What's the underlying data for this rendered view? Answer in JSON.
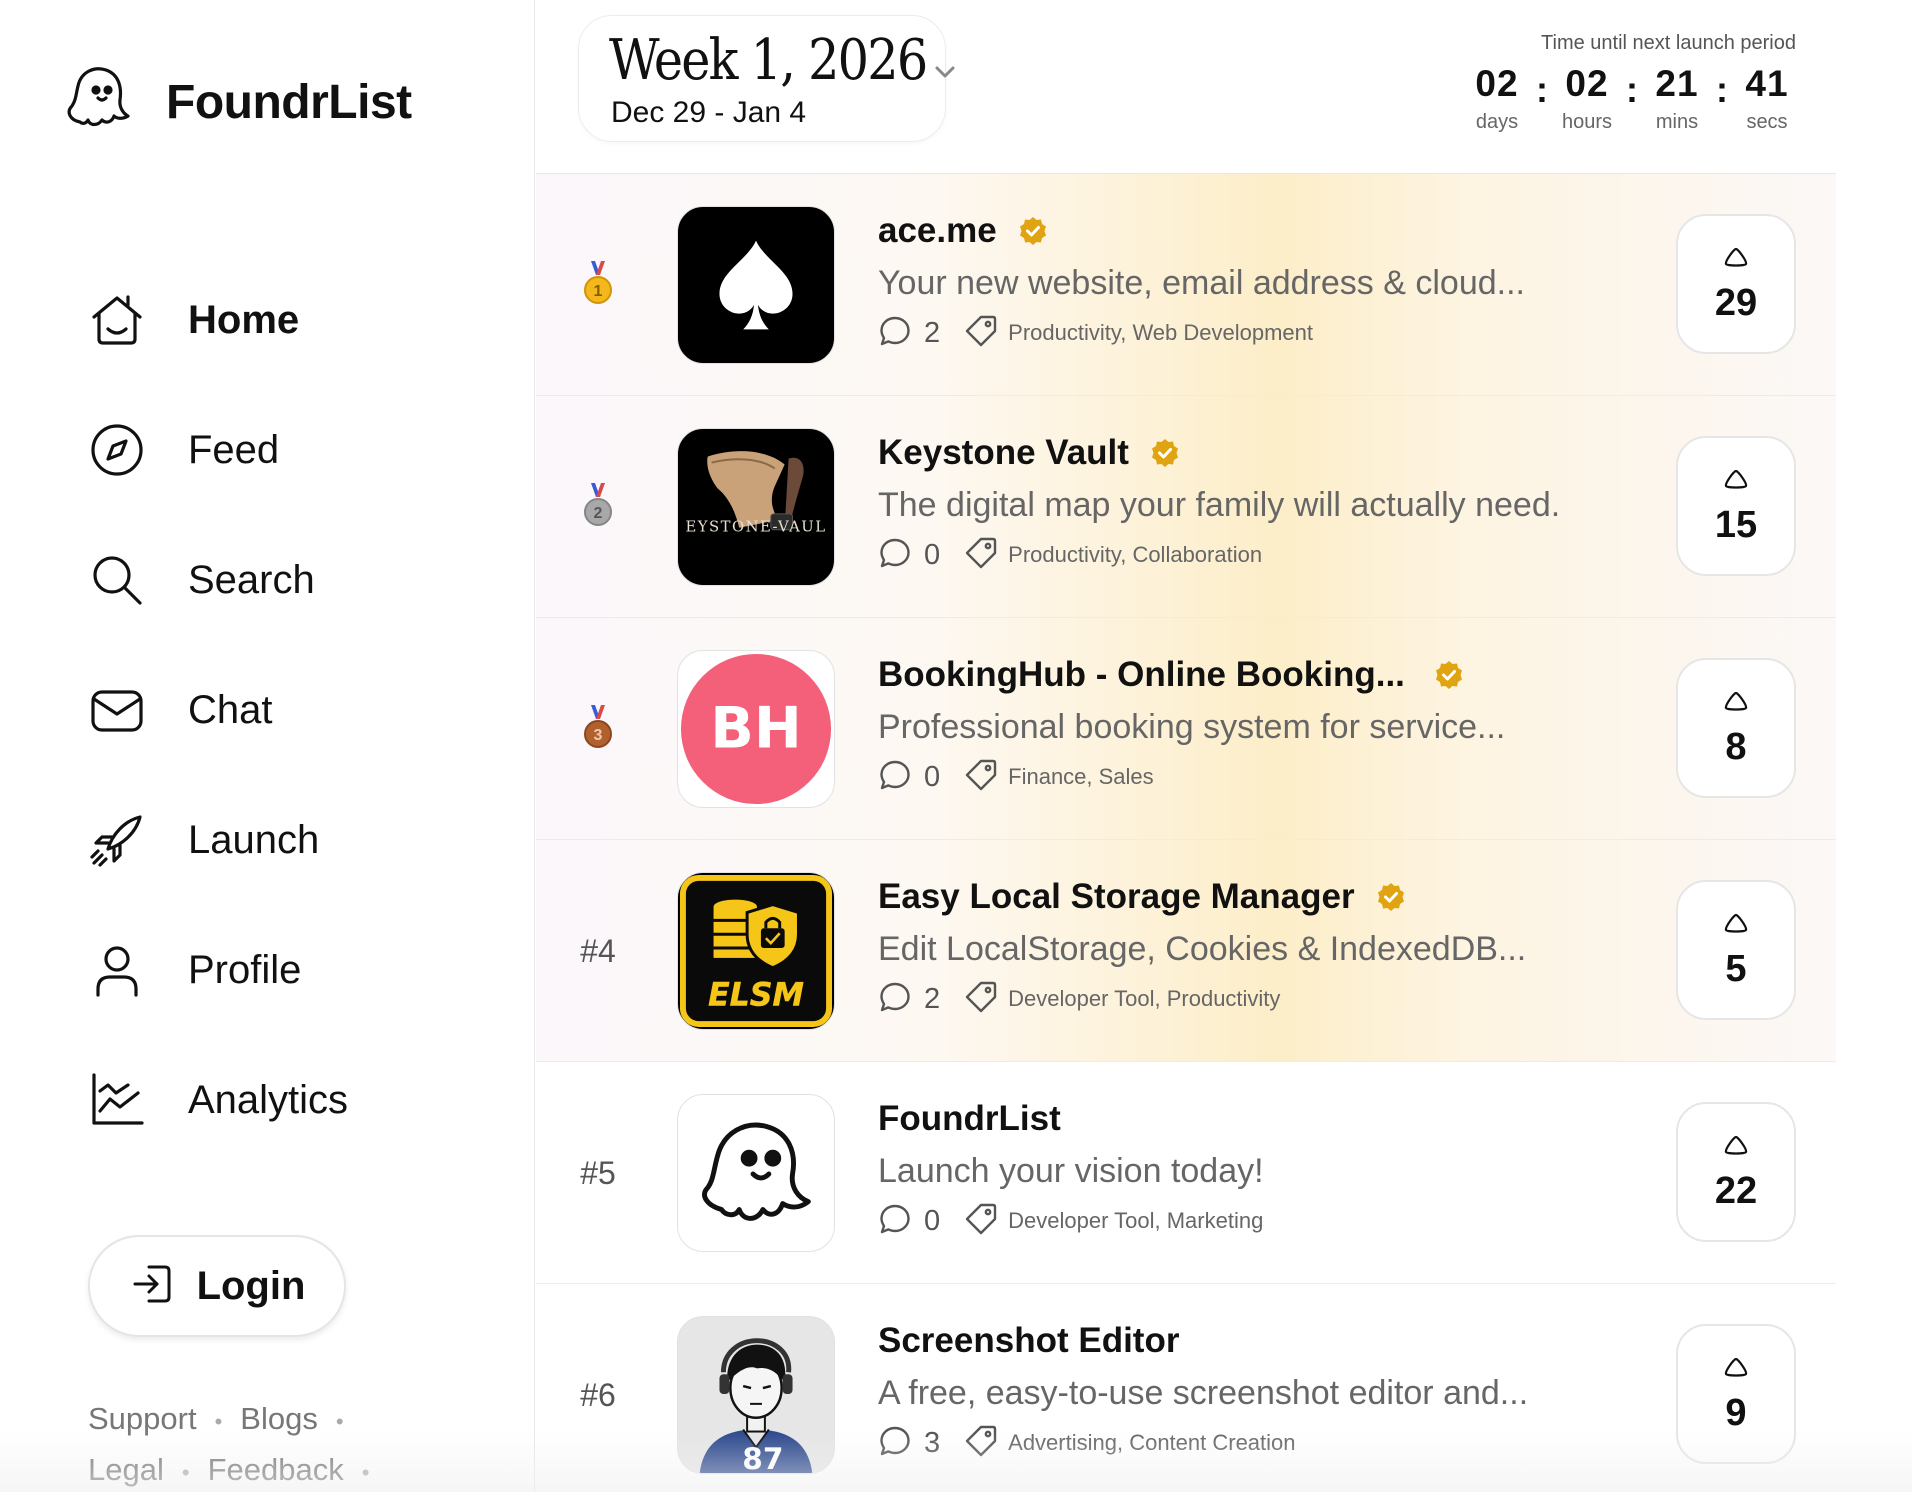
{
  "brand": {
    "name": "FoundrList"
  },
  "nav": [
    {
      "label": "Home",
      "icon": "home-icon",
      "active": true
    },
    {
      "label": "Feed",
      "icon": "compass-icon"
    },
    {
      "label": "Search",
      "icon": "search-icon"
    },
    {
      "label": "Chat",
      "icon": "mail-icon"
    },
    {
      "label": "Launch",
      "icon": "rocket-icon"
    },
    {
      "label": "Profile",
      "icon": "user-icon"
    },
    {
      "label": "Analytics",
      "icon": "chart-icon"
    }
  ],
  "login": {
    "label": "Login"
  },
  "footer": {
    "links": [
      "Support",
      "Blogs",
      "Legal",
      "Feedback"
    ]
  },
  "week": {
    "title": "Week 1, 2026",
    "range": "Dec 29 - Jan 4"
  },
  "countdown": {
    "label": "Time until next launch period",
    "days": "02",
    "hours": "02",
    "mins": "21",
    "secs": "41",
    "days_label": "days",
    "hours_label": "hours",
    "mins_label": "mins",
    "secs_label": "secs"
  },
  "colors": {
    "verified": "#e0a412",
    "bookinghub": "#f4607a",
    "elsm_yellow": "#f5c518"
  },
  "products": [
    {
      "rank": "1",
      "medal": "gold",
      "name": "ace.me",
      "verified": true,
      "description": "Your new website, email address & cloud...",
      "comments": "2",
      "tags": "Productivity, Web Development",
      "votes": "29",
      "logo": "ace-logo"
    },
    {
      "rank": "2",
      "medal": "silver",
      "name": "Keystone Vault",
      "verified": true,
      "description": "The digital map your family will actually need.",
      "comments": "0",
      "tags": "Productivity, Collaboration",
      "votes": "15",
      "logo": "keystone-logo",
      "logo_text": "EYSTONE-VAUL"
    },
    {
      "rank": "3",
      "medal": "bronze",
      "name": "BookingHub - Online Booking...",
      "verified": true,
      "description": "Professional booking system for service...",
      "comments": "0",
      "tags": "Finance, Sales",
      "votes": "8",
      "logo": "bookinghub-logo",
      "logo_text": "BH"
    },
    {
      "rank": "#4",
      "name": "Easy Local Storage Manager",
      "verified": true,
      "description": "Edit LocalStorage, Cookies & IndexedDB...",
      "comments": "2",
      "tags": "Developer Tool, Productivity",
      "votes": "5",
      "logo": "elsm-logo",
      "logo_text": "ELSM"
    },
    {
      "rank": "#5",
      "name": "FoundrList",
      "verified": false,
      "description": "Launch your vision today!",
      "comments": "0",
      "tags": "Developer Tool, Marketing",
      "votes": "22",
      "logo": "ghost-logo"
    },
    {
      "rank": "#6",
      "name": "Screenshot Editor",
      "verified": false,
      "description": "A free, easy-to-use screenshot editor and...",
      "comments": "3",
      "tags": "Advertising, Content Creation",
      "votes": "9",
      "logo": "avatar-logo",
      "logo_text": "87"
    }
  ]
}
